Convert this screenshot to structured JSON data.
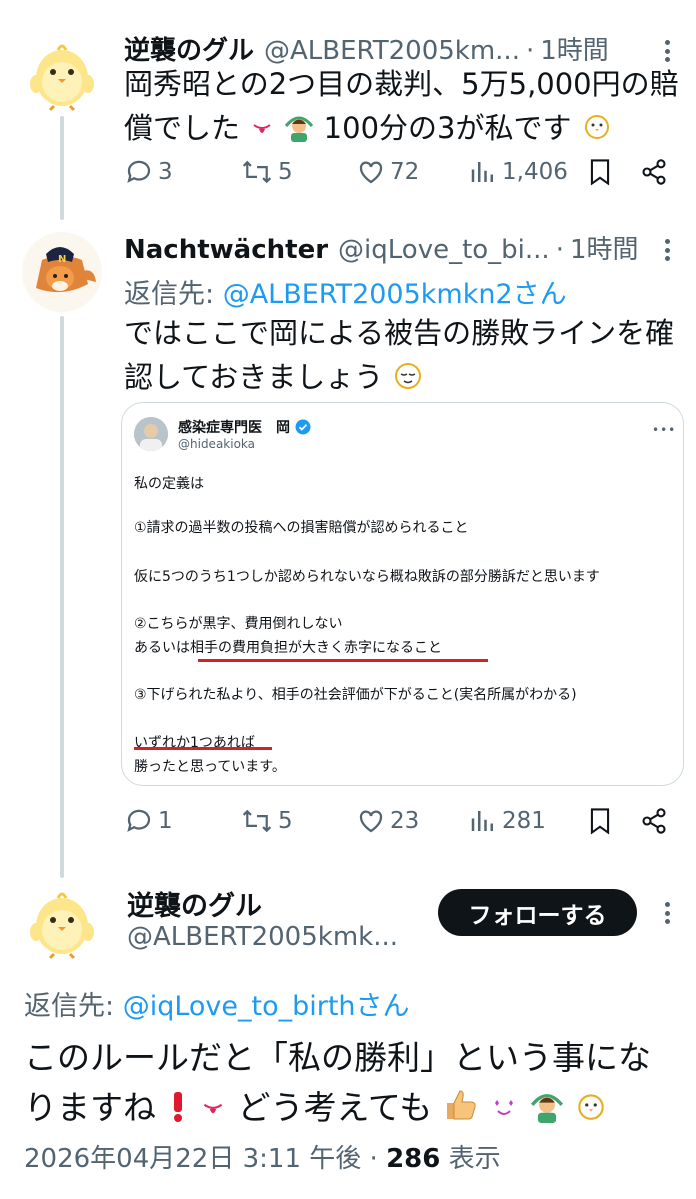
{
  "tweet1": {
    "name": "逆襲のグル",
    "handle": "@ALBERT2005km...",
    "time": "1時間",
    "text_a": "岡秀昭との2つ目の裁判、5万5,000円の賠",
    "text_b_1": "償でした",
    "text_b_2": "100分の3が私です",
    "replies": "3",
    "reposts": "5",
    "likes": "72",
    "views": "1,406"
  },
  "tweet2": {
    "name": "Nachtwächter",
    "handle": "@iqLove_to_bi...",
    "time": "1時間",
    "replying_prefix": "返信先: ",
    "replying_to": "@ALBERT2005kmkn2さん",
    "text_a": "ではここで岡による被告の勝敗ラインを確",
    "text_b": "認しておきましょう",
    "replies": "1",
    "reposts": "5",
    "likes": "23",
    "views": "281"
  },
  "embedded": {
    "name": "感染症専門医　岡",
    "handle": "@hideakioka",
    "line1": "私の定義は",
    "line2": "①請求の過半数の投稿への損害賠償が認められること",
    "line3": "仮に5つのうち1つしか認められないなら概ね敗訴の部分勝訴だと思います",
    "line4": "②こちらが黒字、費用倒れしない",
    "line5": "あるいは相手の費用負担が大きく赤字になること",
    "line6": "③下げられた私より、相手の社会評価が下がること(実名所属がわかる)",
    "line7": "いずれか1つあれば",
    "line8": "勝ったと思っています。"
  },
  "main": {
    "name": "逆襲のグル",
    "handle": "@ALBERT2005kmk...",
    "follow_label": "フォローする",
    "replying_prefix": "返信先: ",
    "replying_to": "@iqLove_to_birthさん",
    "text_a": "このルールだと「私の勝利」という事にな",
    "text_b_1": "りますね",
    "text_b_2": "どう考えても",
    "date": "2026年04月22日 3:11 午後",
    "views_count": "286",
    "views_label": "表示"
  },
  "colors": {
    "text": "#0f1419",
    "secondary": "#536471",
    "link": "#1d9bf0",
    "underline": "#d6202a",
    "button_bg": "#0f1419"
  }
}
